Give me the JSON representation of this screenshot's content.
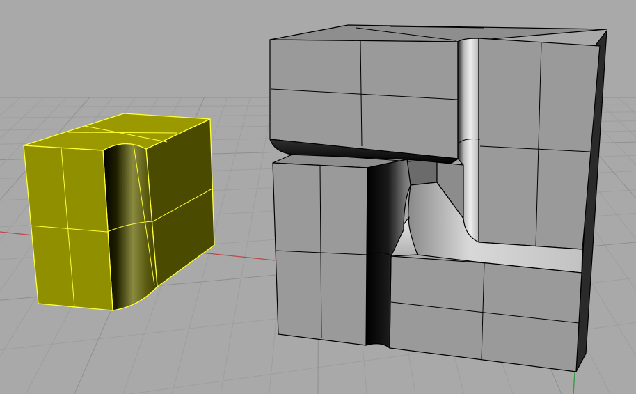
{
  "viewport": {
    "view": "perspective",
    "background_color": "#a9a9a9",
    "grid_visible": true
  },
  "colors": {
    "grid_minor": "#9e9e9e",
    "grid_major": "#8f8f8f",
    "axis_x": "#b84a4a",
    "axis_y": "#3a9a4a",
    "selection": "#ffff33",
    "selected_face": "#8f8f00",
    "selected_face_dark": "#4a4a00",
    "object_face": "#9a9a9a",
    "object_edge": "#000000"
  },
  "objects": [
    {
      "kind": "rounded-box",
      "state": "selected"
    },
    {
      "kind": "polysurface",
      "state": "unselected"
    }
  ]
}
